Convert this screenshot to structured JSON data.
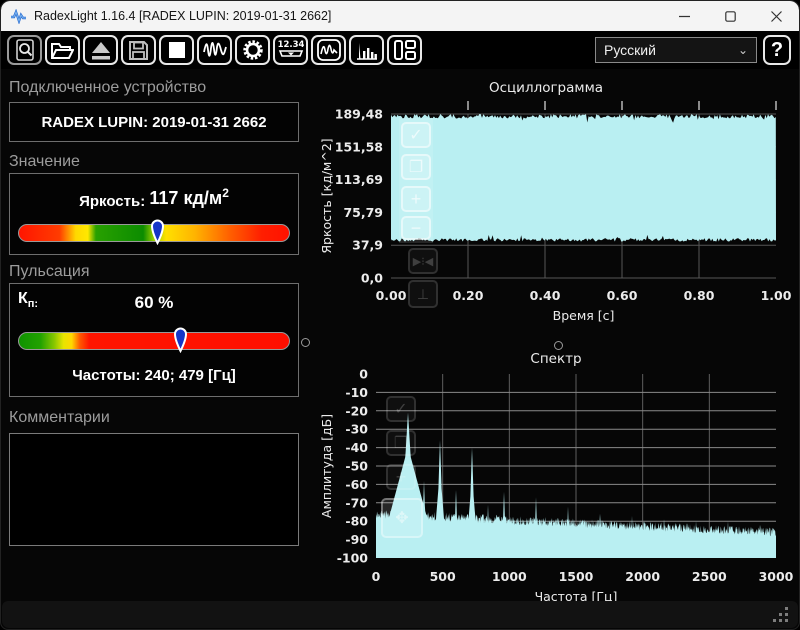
{
  "window": {
    "title": "RadexLight 1.16.4 [RADEX LUPIN: 2019-01-31 2662]",
    "controls": {
      "minimize": "minimize",
      "maximize": "maximize",
      "close": "close"
    }
  },
  "toolbar": {
    "buttons": [
      {
        "name": "report-preview"
      },
      {
        "name": "open-file"
      },
      {
        "name": "eject-device"
      },
      {
        "name": "save"
      },
      {
        "name": "stop"
      },
      {
        "name": "waveform-mode"
      },
      {
        "name": "settings"
      },
      {
        "name": "numeric-display",
        "text": "12.34"
      },
      {
        "name": "oscillogram-view"
      },
      {
        "name": "spectrum-view"
      },
      {
        "name": "layout"
      }
    ],
    "language": {
      "value": "Русский"
    },
    "help_label": "?"
  },
  "device_panel": {
    "header": "Подключенное устройство",
    "device": "RADEX LUPIN: 2019-01-31 2662"
  },
  "value_panel": {
    "header": "Значение",
    "label": "Яркость:",
    "value": "117",
    "unit": "кд/м",
    "unit_sup": "2",
    "marker_pos_pct": 51,
    "marker_color": "#1535c8",
    "gradient": [
      [
        0,
        "#ff1500"
      ],
      [
        0.15,
        "#ff3c00"
      ],
      [
        0.21,
        "#ffd800"
      ],
      [
        0.255,
        "#ffe800"
      ],
      [
        0.285,
        "#28a000"
      ],
      [
        0.46,
        "#0c8c00"
      ],
      [
        0.5,
        "#9cd000"
      ],
      [
        0.545,
        "#ffe000"
      ],
      [
        0.65,
        "#ffb400"
      ],
      [
        0.78,
        "#ff6000"
      ],
      [
        0.9,
        "#ff1e00"
      ],
      [
        1,
        "#ff1200"
      ]
    ]
  },
  "pulsation_panel": {
    "header": "Пульсация",
    "kp_label": "К",
    "kp_sub": "п:",
    "kp_value": "60 %",
    "freq_text": "Частоты: 240; 479 [Гц]",
    "marker_pos_pct": 59.5,
    "marker_color": "#1535c8",
    "gradient": [
      [
        0,
        "#0f9200"
      ],
      [
        0.08,
        "#22a200"
      ],
      [
        0.13,
        "#86c600"
      ],
      [
        0.165,
        "#e8e400"
      ],
      [
        0.195,
        "#ffd800"
      ],
      [
        0.225,
        "#ff5a00"
      ],
      [
        0.26,
        "#ff1500"
      ],
      [
        1,
        "#ff0f00"
      ]
    ]
  },
  "comments_panel": {
    "header": "Комментарии",
    "text": ""
  },
  "chart_data": [
    {
      "type": "area",
      "title": "Осциллограмма",
      "xlabel": "Время [с]",
      "ylabel": "Яркость [кд/м^2]",
      "xlim": [
        0,
        1
      ],
      "ylim": [
        0,
        189.48
      ],
      "fill_color": "#b9eff2",
      "grid": true,
      "yticks": [
        {
          "v": 189.48,
          "label": "189,48"
        },
        {
          "v": 151.58,
          "label": "151,58"
        },
        {
          "v": 113.69,
          "label": "113,69"
        },
        {
          "v": 75.79,
          "label": "75,79"
        },
        {
          "v": 37.9,
          "label": "37,9"
        },
        {
          "v": 0,
          "label": "0,0"
        }
      ],
      "xticks": [
        {
          "v": 0,
          "label": "0.00"
        },
        {
          "v": 0.2,
          "label": "0.20"
        },
        {
          "v": 0.4,
          "label": "0.40"
        },
        {
          "v": 0.6,
          "label": "0.60"
        },
        {
          "v": 0.8,
          "label": "0.80"
        },
        {
          "v": 1,
          "label": "1.00"
        }
      ],
      "envelope": {
        "top": 189.48,
        "bottom": 42,
        "top_noise": 6,
        "bottom_noise": 3.5
      }
    },
    {
      "type": "area",
      "title": "Спектр",
      "xlabel": "Частота [Гц]",
      "ylabel": "Амплитуда [дБ]",
      "xlim": [
        0,
        3000
      ],
      "ylim": [
        -100,
        0
      ],
      "fill_color": "#b9eff2",
      "grid": true,
      "yticks": [
        {
          "v": 0,
          "label": "0"
        },
        {
          "v": -10,
          "label": "-10"
        },
        {
          "v": -20,
          "label": "-20"
        },
        {
          "v": -30,
          "label": "-30"
        },
        {
          "v": -40,
          "label": "-40"
        },
        {
          "v": -50,
          "label": "-50"
        },
        {
          "v": -60,
          "label": "-60"
        },
        {
          "v": -70,
          "label": "-70"
        },
        {
          "v": -80,
          "label": "-80"
        },
        {
          "v": -90,
          "label": "-90"
        },
        {
          "v": -100,
          "label": "-100"
        }
      ],
      "xticks": [
        {
          "v": 0,
          "label": "0"
        },
        {
          "v": 500,
          "label": "500"
        },
        {
          "v": 1000,
          "label": "1000"
        },
        {
          "v": 1500,
          "label": "1500"
        },
        {
          "v": 2000,
          "label": "2000"
        },
        {
          "v": 2500,
          "label": "2500"
        },
        {
          "v": 3000,
          "label": "3000"
        }
      ],
      "noise_floor": {
        "start": -76,
        "end": -86,
        "jitter": 5
      },
      "peaks": [
        {
          "f": 240,
          "db": -21
        },
        {
          "f": 360,
          "db": -58
        },
        {
          "f": 480,
          "db": -36
        },
        {
          "f": 600,
          "db": -63
        },
        {
          "f": 720,
          "db": -40
        },
        {
          "f": 840,
          "db": -71
        },
        {
          "f": 960,
          "db": -64
        },
        {
          "f": 1200,
          "db": -67
        },
        {
          "f": 1440,
          "db": -72
        },
        {
          "f": 1680,
          "db": -76
        },
        {
          "f": 1920,
          "db": -77
        },
        {
          "f": 2160,
          "db": -79
        },
        {
          "f": 2400,
          "db": -80
        },
        {
          "f": 2640,
          "db": -80
        },
        {
          "f": 2880,
          "db": -82
        }
      ]
    }
  ]
}
